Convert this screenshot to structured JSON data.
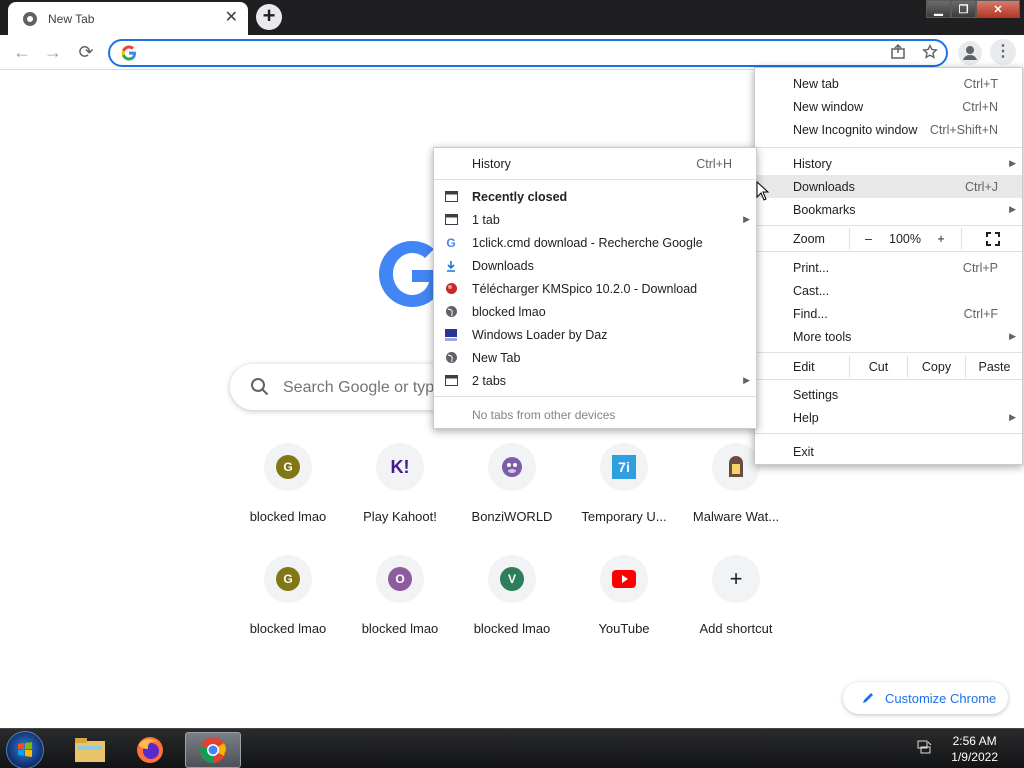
{
  "tab": {
    "title": "New Tab",
    "close": "✕"
  },
  "newtab": "+",
  "window": {
    "min": "▁",
    "max": "❐",
    "close": "✕"
  },
  "toolbar": {
    "back": "←",
    "forward": "→",
    "reload": "⟳",
    "address_value": "",
    "menu": "⋮"
  },
  "search": {
    "placeholder": "Search Google or type a URL"
  },
  "shortcuts": [
    {
      "label": "blocked lmao",
      "icon": "G",
      "color": "#827717"
    },
    {
      "label": "Play Kahoot!",
      "icon": "K!",
      "color": "#46178f"
    },
    {
      "label": "BonziWORLD",
      "icon": "bonzi-icon",
      "color": "#7b5ea7"
    },
    {
      "label": "Temporary U...",
      "icon": "7i",
      "color": "#2f9fe0"
    },
    {
      "label": "Malware Wat...",
      "icon": "door-icon",
      "color": "#6d4c41"
    },
    {
      "label": "blocked lmao",
      "icon": "G",
      "color": "#827717"
    },
    {
      "label": "blocked lmao",
      "icon": "O",
      "color": "#8e5c9e"
    },
    {
      "label": "blocked lmao",
      "icon": "V",
      "color": "#2e7d5b"
    },
    {
      "label": "YouTube",
      "icon": "youtube-icon",
      "color": "#ff0000"
    },
    {
      "label": "Add shortcut",
      "icon": "+",
      "color": "#202124"
    }
  ],
  "customize": "Customize Chrome",
  "main_menu": {
    "new_tab": {
      "label": "New tab",
      "shortcut": "Ctrl+T"
    },
    "new_window": {
      "label": "New window",
      "shortcut": "Ctrl+N"
    },
    "incognito": {
      "label": "New Incognito window",
      "shortcut": "Ctrl+Shift+N"
    },
    "history": {
      "label": "History"
    },
    "downloads": {
      "label": "Downloads",
      "shortcut": "Ctrl+J"
    },
    "bookmarks": {
      "label": "Bookmarks"
    },
    "zoom": {
      "label": "Zoom",
      "minus": "–",
      "value": "100%",
      "plus": "+"
    },
    "print": {
      "label": "Print...",
      "shortcut": "Ctrl+P"
    },
    "cast": {
      "label": "Cast..."
    },
    "find": {
      "label": "Find...",
      "shortcut": "Ctrl+F"
    },
    "more_tools": {
      "label": "More tools"
    },
    "edit": {
      "label": "Edit",
      "cut": "Cut",
      "copy": "Copy",
      "paste": "Paste"
    },
    "settings": {
      "label": "Settings"
    },
    "help": {
      "label": "Help"
    },
    "exit": {
      "label": "Exit"
    }
  },
  "history_menu": {
    "history": {
      "label": "History",
      "shortcut": "Ctrl+H"
    },
    "recently_closed": "Recently closed",
    "items": [
      {
        "label": "1 tab",
        "icon": "window-icon",
        "arrow": true
      },
      {
        "label": "1click.cmd download - Recherche Google",
        "icon": "google-icon",
        "arrow": false
      },
      {
        "label": "Downloads",
        "icon": "download-icon",
        "arrow": false
      },
      {
        "label": "Télécharger KMSpico 10.2.0 - Download",
        "icon": "kmspico-icon",
        "arrow": false
      },
      {
        "label": "blocked lmao",
        "icon": "globe-icon",
        "arrow": false
      },
      {
        "label": "Windows Loader by Daz",
        "icon": "loader-icon",
        "arrow": false
      },
      {
        "label": "New Tab",
        "icon": "globe-icon",
        "arrow": false
      },
      {
        "label": "2 tabs",
        "icon": "window-icon",
        "arrow": true
      }
    ],
    "other_devices": "No tabs from other devices"
  },
  "taskbar": {
    "time": "2:56 AM",
    "date": "1/9/2022"
  }
}
